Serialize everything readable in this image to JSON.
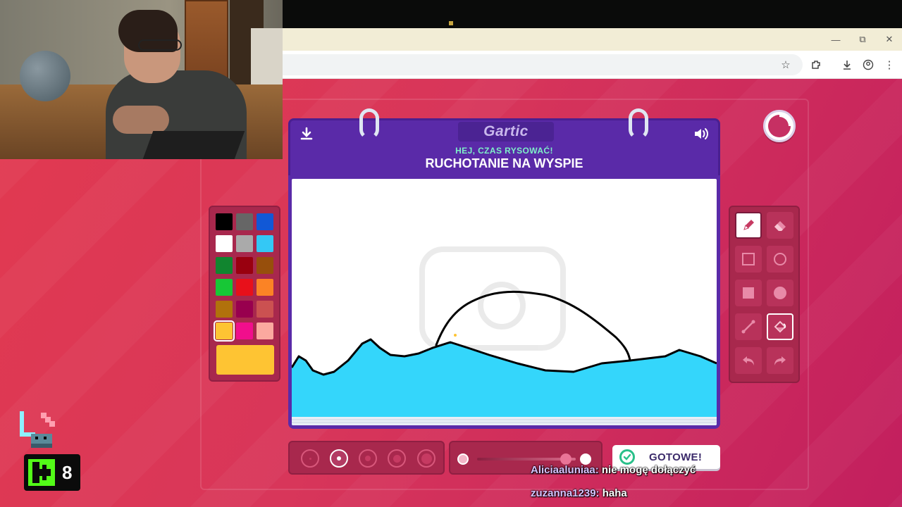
{
  "game": {
    "logo": "Gartic",
    "subtitle": "HEJ, CZAS RYSOWAĆ!",
    "prompt_title": "RUCHOTANIE NA WYSPIE",
    "done_label": "GOTOWE!",
    "watermark": "Gartic PHONE"
  },
  "palette": {
    "colors": [
      "#000000",
      "#666666",
      "#1158d6",
      "#ffffff",
      "#aaaaaa",
      "#34c8f5",
      "#11852f",
      "#99000f",
      "#974f0c",
      "#17c736",
      "#e8101a",
      "#fb8325",
      "#b1710c",
      "#98004e",
      "#cb5151",
      "#fec433",
      "#f10e8c",
      "#fba99f"
    ],
    "selected_index": 15,
    "current_color": "#fec433"
  },
  "tools": [
    {
      "name": "pencil",
      "active": true
    },
    {
      "name": "eraser",
      "active": false
    },
    {
      "name": "rectangle-outline",
      "active": false
    },
    {
      "name": "circle-outline",
      "active": false
    },
    {
      "name": "rectangle-filled",
      "active": false
    },
    {
      "name": "circle-filled",
      "active": false
    },
    {
      "name": "line",
      "active": false
    },
    {
      "name": "fill-bucket",
      "active": false
    },
    {
      "name": "undo",
      "active": false
    },
    {
      "name": "redo",
      "active": false
    }
  ],
  "brush_sizes": {
    "count": 5,
    "selected_index": 1
  },
  "chat": [
    {
      "user": "Aliciaaluniaa:",
      "message": "nie mogę dołączyć"
    },
    {
      "user": "zuzanna1239:",
      "message": "haha"
    }
  ],
  "stream": {
    "viewer_count": "8"
  },
  "colors": {
    "header_purple": "#5a2aa8",
    "panel": "#a8284d",
    "water": "#34d6fb",
    "accent_green": "#2ac08a"
  }
}
